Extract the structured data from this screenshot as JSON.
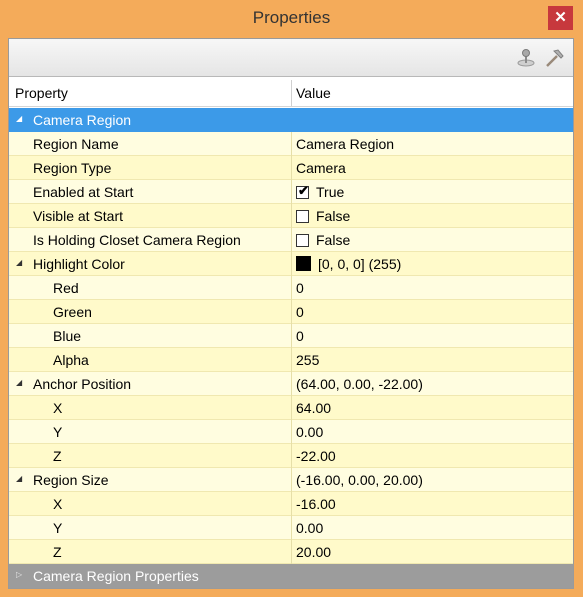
{
  "window": {
    "title": "Properties",
    "close_glyph": "✕"
  },
  "toolbar": {
    "tools": [
      "joystick-icon",
      "hammer-icon"
    ]
  },
  "grid": {
    "header": {
      "property": "Property",
      "value": "Value"
    },
    "rows": [
      {
        "kind": "category",
        "label": "Camera Region",
        "expanded": true
      },
      {
        "label": "Region Name",
        "value": "Camera Region"
      },
      {
        "label": "Region Type",
        "value": "Camera"
      },
      {
        "label": "Enabled at Start",
        "checked": true,
        "value": "True"
      },
      {
        "label": "Visible at Start",
        "checked": false,
        "value": "False"
      },
      {
        "label": "Is Holding Closet Camera Region",
        "checked": false,
        "value": "False"
      },
      {
        "label": "Highlight Color",
        "value": "[0, 0, 0] (255)",
        "color": "#000000",
        "expandable": true
      },
      {
        "label": "Red",
        "value": "0",
        "indent": 2
      },
      {
        "label": "Green",
        "value": "0",
        "indent": 2
      },
      {
        "label": "Blue",
        "value": "0",
        "indent": 2
      },
      {
        "label": "Alpha",
        "value": "255",
        "indent": 2
      },
      {
        "label": "Anchor Position",
        "value": "(64.00, 0.00, -22.00)",
        "expandable": true
      },
      {
        "label": "X",
        "value": "64.00",
        "indent": 2
      },
      {
        "label": "Y",
        "value": "0.00",
        "indent": 2
      },
      {
        "label": "Z",
        "value": "-22.00",
        "indent": 2
      },
      {
        "label": "Region Size",
        "value": "(-16.00, 0.00, 20.00)",
        "expandable": true
      },
      {
        "label": "X",
        "value": "-16.00",
        "indent": 2
      },
      {
        "label": "Y",
        "value": "0.00",
        "indent": 2
      },
      {
        "label": "Z",
        "value": "20.00",
        "indent": 2
      },
      {
        "kind": "category-collapsed",
        "label": "Camera Region Properties",
        "expanded": false
      }
    ]
  },
  "colors": {
    "accent": "#3c9ae8",
    "frame": "#f4ab5a",
    "close": "#c7383d"
  }
}
